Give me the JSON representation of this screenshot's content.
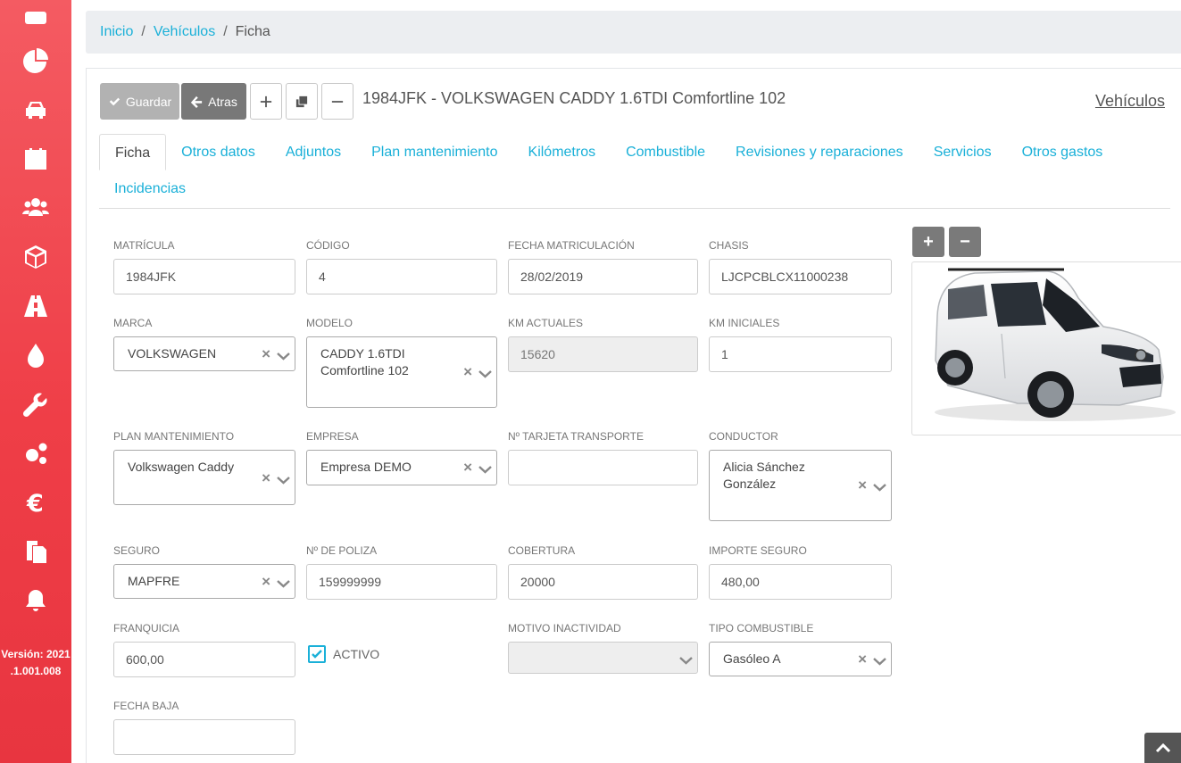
{
  "breadcrumb": {
    "items": [
      "Inicio",
      "Vehículos"
    ],
    "current": "Ficha",
    "sep": "/"
  },
  "sidebar": {
    "icons": [
      "monitor-icon",
      "pie-chart-icon",
      "car-icon",
      "calendar-icon",
      "users-icon",
      "box-icon",
      "road-icon",
      "fuel-drop-icon",
      "wrench-icon",
      "gears-icon",
      "euro-icon",
      "documents-icon",
      "bell-icon"
    ],
    "version_line1": "Versión: 2021",
    "version_line2": ".1.001.008"
  },
  "toolbar": {
    "save_label": "Guardar",
    "back_label": "Atras"
  },
  "record": {
    "title": "1984JFK - VOLKSWAGEN CADDY 1.6TDI Comfortline 102",
    "section_link": "Vehículos"
  },
  "tabs": {
    "row1": [
      "Ficha",
      "Otros datos",
      "Adjuntos",
      "Plan mantenimiento",
      "Kilómetros",
      "Combustible",
      "Revisiones y reparaciones",
      "Servicios",
      "Otros gastos"
    ],
    "row2": [
      "Incidencias"
    ],
    "active": "Ficha"
  },
  "form": {
    "matricula": {
      "label": "MATRÍCULA",
      "value": "1984JFK"
    },
    "codigo": {
      "label": "CÓDIGO",
      "value": "4"
    },
    "fecha_matriculacion": {
      "label": "FECHA MATRICULACIÓN",
      "value": "28/02/2019"
    },
    "chasis": {
      "label": "CHASIS",
      "value": "LJCPCBLCX11000238"
    },
    "marca": {
      "label": "MARCA",
      "value": "VOLKSWAGEN"
    },
    "modelo": {
      "label": "MODELO",
      "value": "CADDY 1.6TDI Comfortline 102"
    },
    "km_actuales": {
      "label": "KM ACTUALES",
      "value": "15620"
    },
    "km_iniciales": {
      "label": "KM INICIALES",
      "value": "1"
    },
    "plan_mantenimiento": {
      "label": "PLAN MANTENIMIENTO",
      "value": "Volkswagen Caddy"
    },
    "empresa": {
      "label": "EMPRESA",
      "value": "Empresa DEMO"
    },
    "tarjeta_transporte": {
      "label": "Nº TARJETA TRANSPORTE",
      "value": ""
    },
    "conductor": {
      "label": "CONDUCTOR",
      "value": "Alicia Sánchez González"
    },
    "seguro": {
      "label": "SEGURO",
      "value": "MAPFRE"
    },
    "poliza": {
      "label": "Nº DE POLIZA",
      "value": "159999999"
    },
    "cobertura": {
      "label": "COBERTURA",
      "value": "20000"
    },
    "importe_seguro": {
      "label": "IMPORTE SEGURO",
      "value": "480,00"
    },
    "franquicia": {
      "label": "FRANQUICIA",
      "value": "600,00"
    },
    "activo": {
      "label": "ACTIVO",
      "checked": true
    },
    "motivo_inactividad": {
      "label": "MOTIVO INACTIVIDAD",
      "value": ""
    },
    "tipo_combustible": {
      "label": "TIPO COMBUSTIBLE",
      "value": "Gasóleo A"
    },
    "fecha_baja": {
      "label": "FECHA BAJA",
      "value": ""
    }
  },
  "image": {
    "add_label": "+",
    "remove_label": "−",
    "subject": "white van"
  },
  "colors": {
    "sidebar": "#ef3e47",
    "link": "#1ab0d8",
    "save_button": "#b2b2b2",
    "back_button": "#787878"
  }
}
